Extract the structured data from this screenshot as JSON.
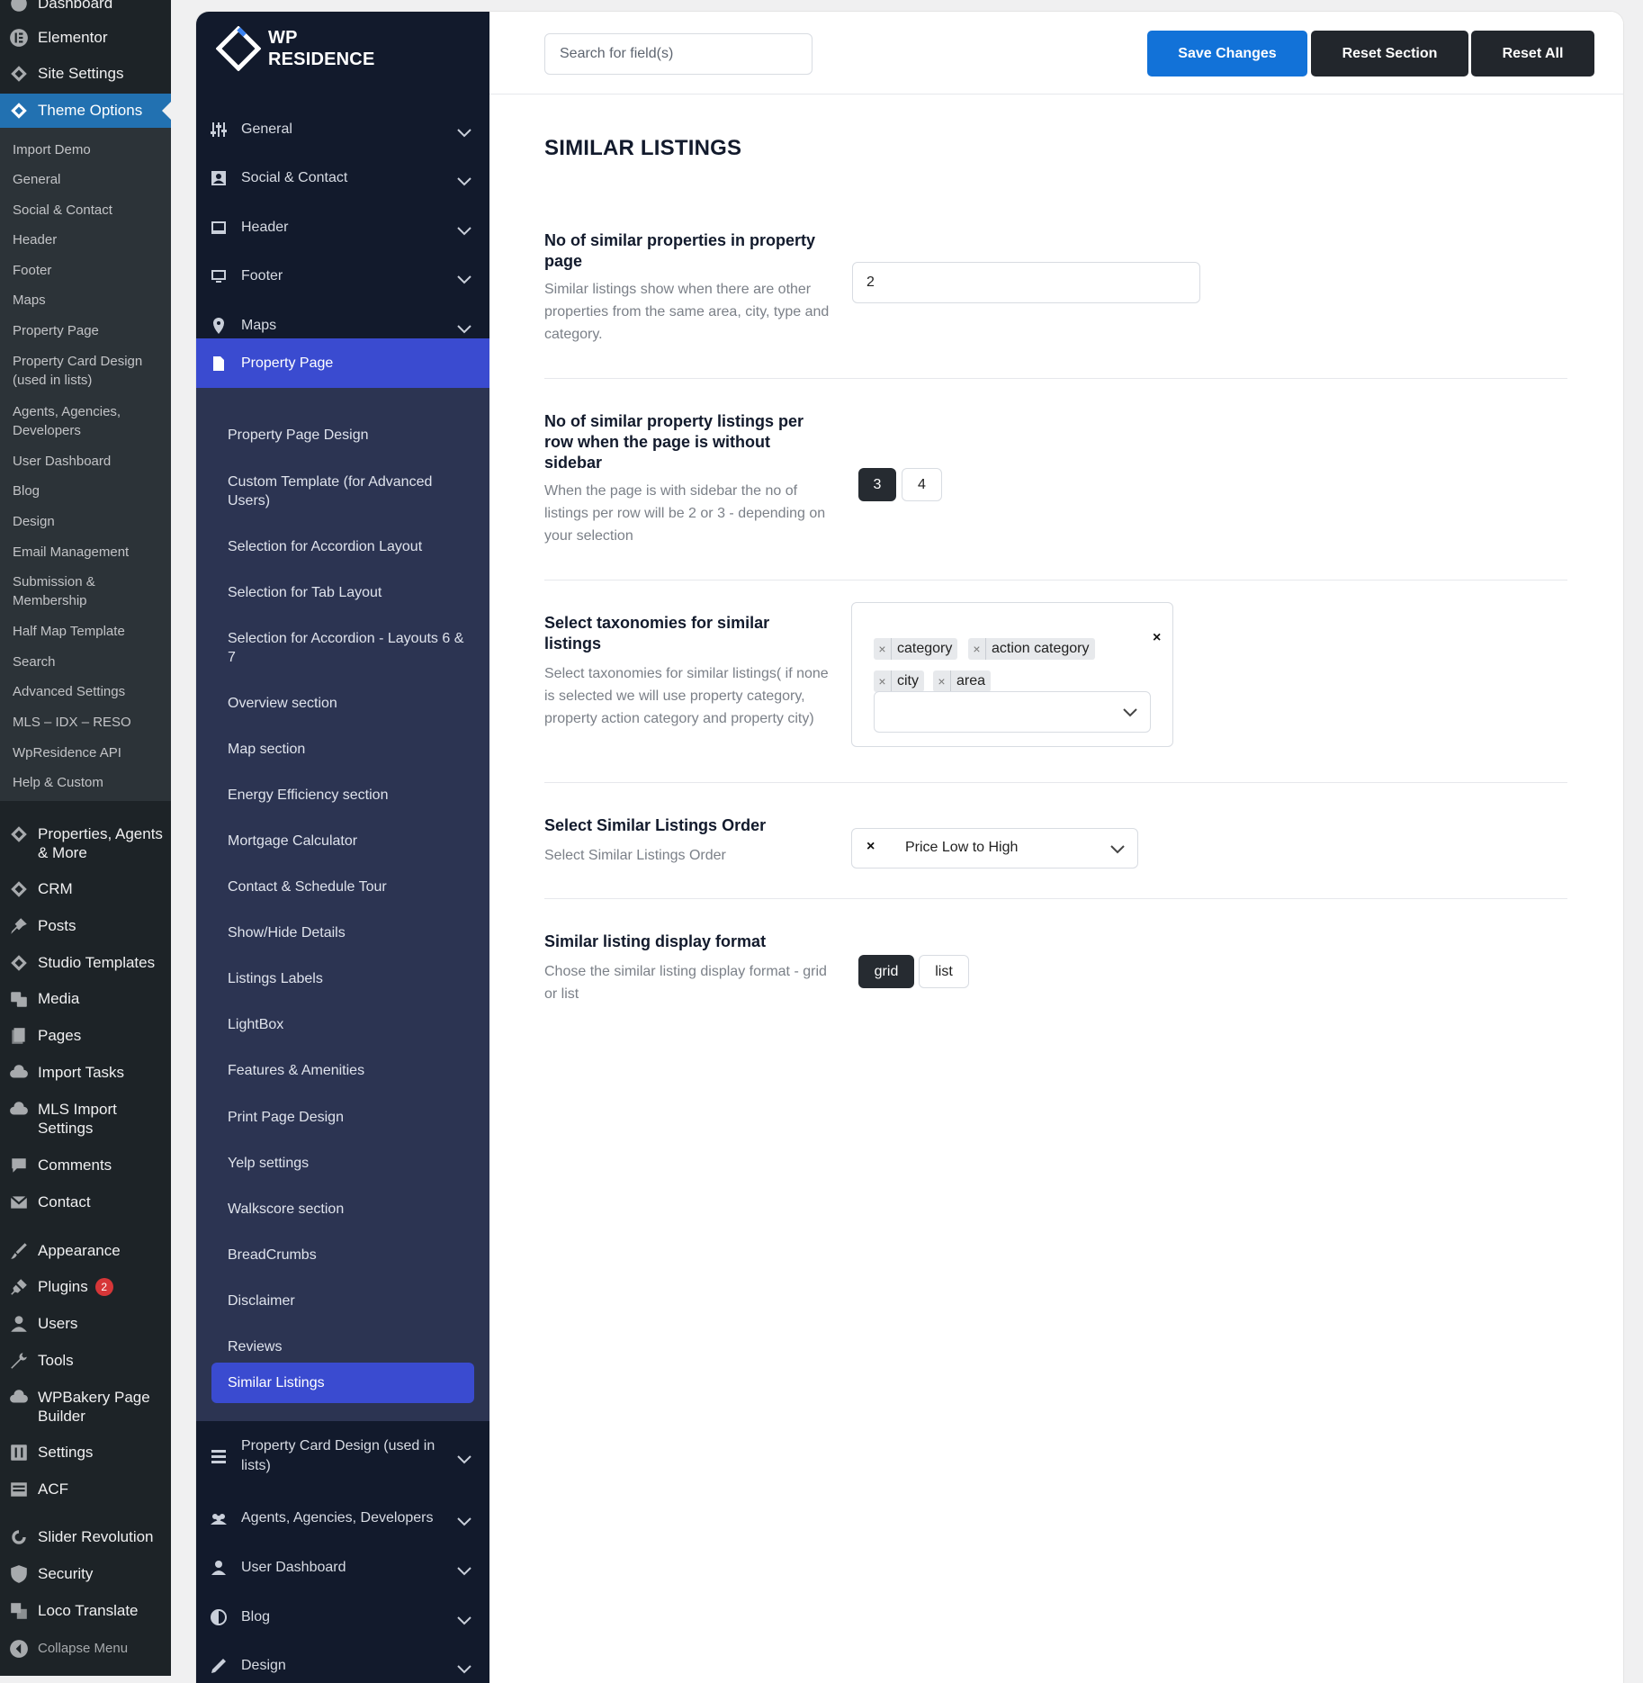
{
  "wp_menu": {
    "dashboard": "Dashboard",
    "elementor": "Elementor",
    "site_settings": "Site Settings",
    "theme_options": "Theme Options",
    "submenu": [
      "Import Demo",
      "General",
      "Social & Contact",
      "Header",
      "Footer",
      "Maps",
      "Property Page",
      "Property Card Design (used in lists)",
      "Agents, Agencies, Developers",
      "User Dashboard",
      "Blog",
      "Design",
      "Email Management",
      "Submission & Membership",
      "Half Map Template",
      "Search",
      "Advanced Settings",
      "MLS – IDX – RESO",
      "WpResidence API",
      "Help & Custom"
    ],
    "properties": "Properties, Agents & More",
    "crm": "CRM",
    "posts": "Posts",
    "studio_templates": "Studio Templates",
    "media": "Media",
    "pages": "Pages",
    "import_tasks": "Import Tasks",
    "mls_import": "MLS Import Settings",
    "comments": "Comments",
    "contact": "Contact",
    "appearance": "Appearance",
    "plugins": "Plugins",
    "plugins_badge": "2",
    "users": "Users",
    "tools": "Tools",
    "wpbakery": "WPBakery Page Builder",
    "settings": "Settings",
    "acf": "ACF",
    "slider_revolution": "Slider Revolution",
    "security": "Security",
    "loco_translate": "Loco Translate",
    "collapse": "Collapse Menu"
  },
  "theme": {
    "logo_line1": "WP",
    "logo_line2": "RESIDENCE",
    "nav": {
      "general": "General",
      "social": "Social & Contact",
      "header": "Header",
      "footer": "Footer",
      "maps": "Maps",
      "property_page": "Property Page",
      "property_card": "Property Card Design (used in lists)",
      "agents": "Agents, Agencies, Developers",
      "user_dashboard": "User Dashboard",
      "blog": "Blog",
      "design": "Design"
    },
    "subnav": [
      "Property Page Design",
      "Custom Template (for Advanced Users)",
      "Selection for Accordion Layout",
      "Selection for Tab Layout",
      "Selection for Accordion - Layouts 6 & 7",
      "Overview section",
      "Map section",
      "Energy Efficiency section",
      "Mortgage Calculator",
      "Contact & Schedule Tour",
      "Show/Hide Details",
      "Listings Labels",
      "LightBox",
      "Features & Amenities",
      "Print Page Design",
      "Yelp settings",
      "Walkscore section",
      "BreadCrumbs",
      "Disclaimer",
      "Reviews"
    ],
    "subnav_active": "Similar Listings"
  },
  "toolbar": {
    "search_placeholder": "Search for field(s)",
    "save": "Save Changes",
    "reset_section": "Reset Section",
    "reset_all": "Reset All"
  },
  "section": {
    "title": "SIMILAR LISTINGS",
    "row1": {
      "title": "No of similar properties in property page",
      "desc": "Similar listings show when there are other properties from the same area, city, type and category.",
      "value": "2"
    },
    "row2": {
      "title": "No of similar property listings per row when the page is without sidebar",
      "desc": "When the page is with sidebar the no of listings per row will be 2 or 3 - depending on your selection",
      "options": [
        "3",
        "4"
      ],
      "selected": "3"
    },
    "row3": {
      "title": "Select taxonomies for similar listings",
      "desc": "Select taxonomies for similar listings( if none is selected we will use property category, property action category and property city)",
      "tags": [
        "category",
        "action category",
        "city",
        "area"
      ],
      "tag_remove": "×",
      "clear": "×"
    },
    "row4": {
      "title": "Select Similar Listings Order",
      "desc": "Select Similar Listings Order",
      "value": "Price Low to High",
      "clear": "×"
    },
    "row5": {
      "title": "Similar listing display format",
      "desc": "Chose the similar listing display format - grid or list",
      "options": [
        "grid",
        "list"
      ],
      "selected": "grid"
    }
  },
  "colors": {
    "wp_sidebar": "#1d2327",
    "wp_active": "#2271b1",
    "theme_nav": "#121a2c",
    "theme_subnav": "#2c3452",
    "accent": "#3a4bd0",
    "save_button": "#1272d8",
    "dark_button": "#22262c"
  }
}
